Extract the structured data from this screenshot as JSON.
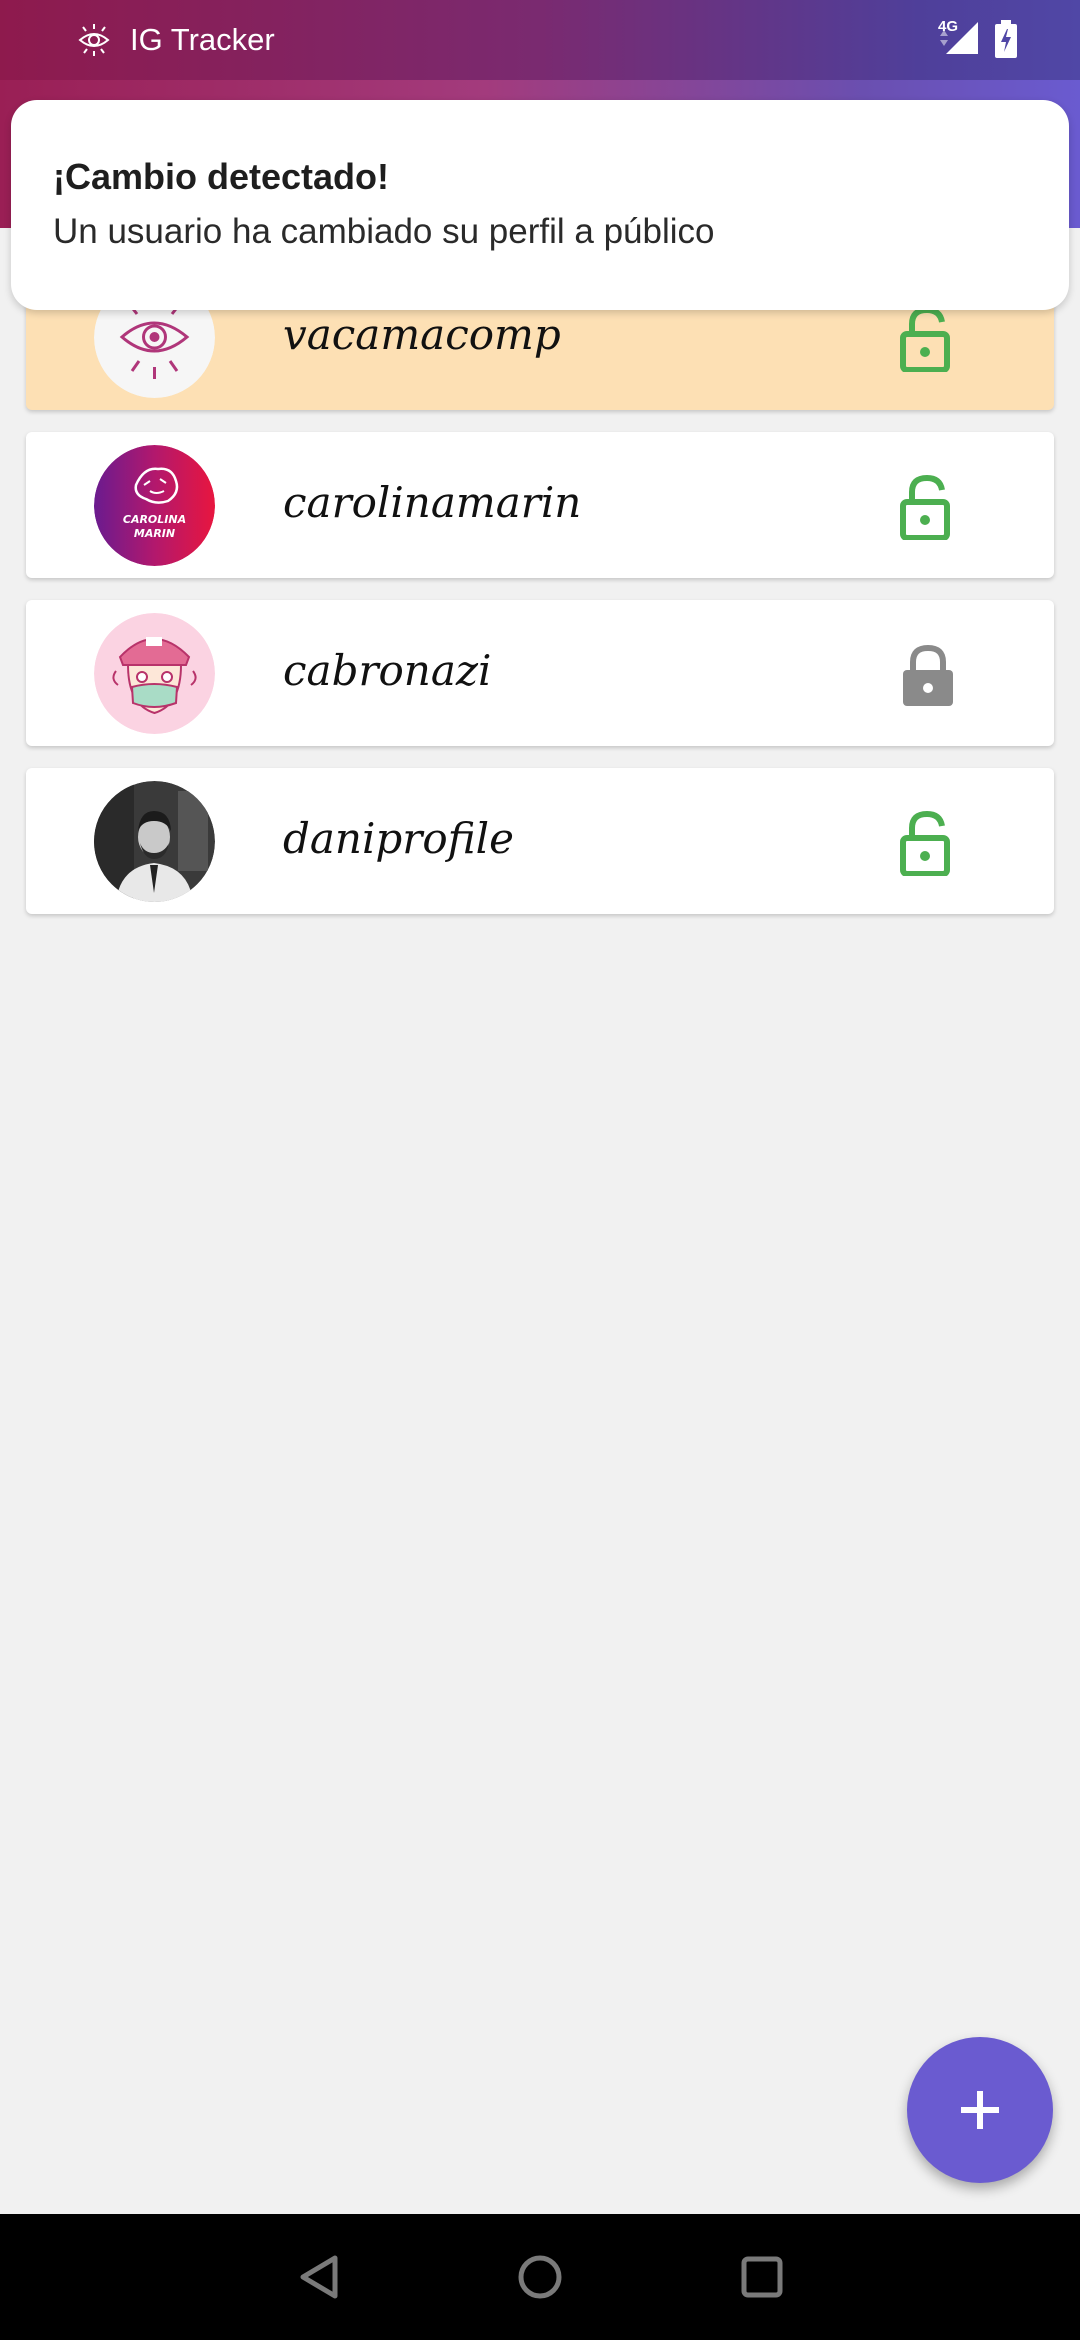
{
  "status_bar": {
    "app_title": "IG Tracker",
    "network_label": "4G"
  },
  "notification": {
    "title": "¡Cambio detectado!",
    "text": "Un usuario ha cambiado su perfil a público"
  },
  "users": [
    {
      "username": "vacamacomp",
      "lock_state": "unlocked",
      "highlighted": true,
      "avatar": "eye-logo-avatar"
    },
    {
      "username": "carolinamarin",
      "lock_state": "unlocked",
      "highlighted": false,
      "avatar": "carolina-marin-logo-avatar",
      "avatar_text": "CAROLINA MARIN"
    },
    {
      "username": "cabronazi",
      "lock_state": "locked",
      "highlighted": false,
      "avatar": "cartoon-avatar"
    },
    {
      "username": "daniprofile",
      "lock_state": "unlocked",
      "highlighted": false,
      "avatar": "photo-avatar"
    }
  ],
  "fab": {
    "icon": "plus-icon"
  },
  "navbar": {
    "icons": [
      "back-icon",
      "home-icon",
      "recents-icon"
    ]
  },
  "colors": {
    "unlocked": "#4caf50",
    "locked": "#8a8a8a",
    "highlight": "#fde0b4",
    "accent": "#6a5bd0"
  }
}
